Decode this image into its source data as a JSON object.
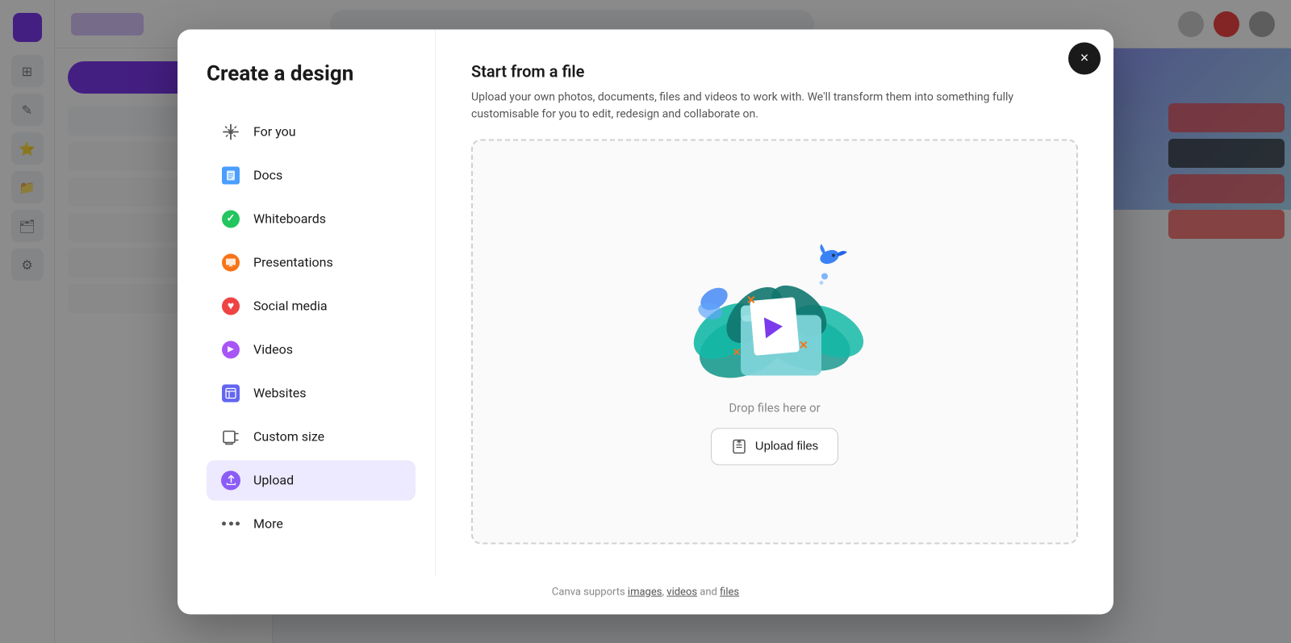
{
  "modal": {
    "title": "Create a design",
    "close_label": "×",
    "nav": {
      "items": [
        {
          "id": "for-you",
          "label": "For you",
          "icon": "sparkle-icon",
          "active": false
        },
        {
          "id": "docs",
          "label": "Docs",
          "icon": "doc-icon",
          "active": false
        },
        {
          "id": "whiteboards",
          "label": "Whiteboards",
          "icon": "whiteboard-icon",
          "active": false
        },
        {
          "id": "presentations",
          "label": "Presentations",
          "icon": "presentation-icon",
          "active": false
        },
        {
          "id": "social-media",
          "label": "Social media",
          "icon": "social-icon",
          "active": false
        },
        {
          "id": "videos",
          "label": "Videos",
          "icon": "video-icon",
          "active": false
        },
        {
          "id": "websites",
          "label": "Websites",
          "icon": "website-icon",
          "active": false
        },
        {
          "id": "custom-size",
          "label": "Custom size",
          "icon": "custom-icon",
          "active": false
        },
        {
          "id": "upload",
          "label": "Upload",
          "icon": "upload-icon",
          "active": true
        },
        {
          "id": "more",
          "label": "More",
          "icon": "more-icon",
          "active": false
        }
      ]
    },
    "content": {
      "title": "Start from a file",
      "description": "Upload your own photos, documents, files and videos to work with. We'll transform them into something fully customisable for you to edit, redesign and collaborate on.",
      "drop_text": "Drop files here or",
      "upload_button_label": "Upload files",
      "footer_text_prefix": "Canva supports ",
      "footer_links": [
        "images",
        "videos",
        "files"
      ],
      "footer_text_mid1": ", ",
      "footer_text_mid2": " and ",
      "footer_text_suffix": ""
    }
  }
}
